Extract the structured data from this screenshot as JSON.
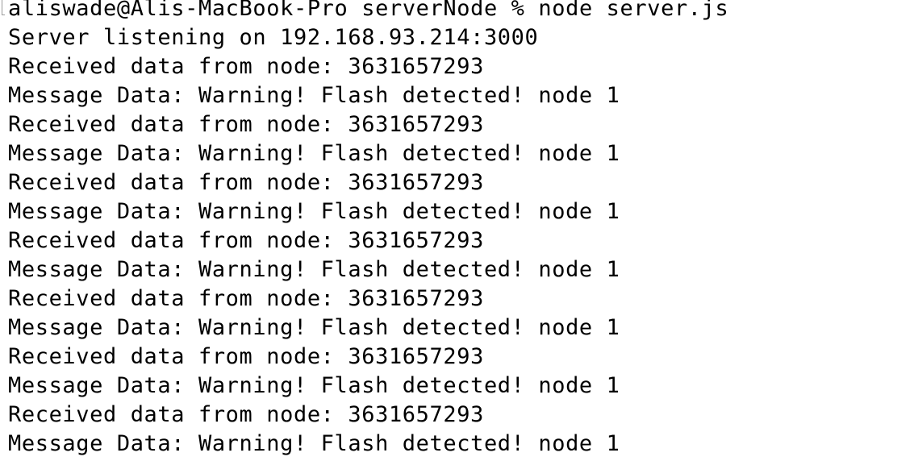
{
  "terminal": {
    "prompt": {
      "user_host": "aliswade@Alis-MacBook-Pro",
      "cwd": "serverNode",
      "symbol": "%",
      "command": "node server.js"
    },
    "lines": [
      "Server listening on 192.168.93.214:3000",
      "Received data from node: 3631657293",
      "Message Data: Warning! Flash detected! node 1",
      "Received data from node: 3631657293",
      "Message Data: Warning! Flash detected! node 1",
      "Received data from node: 3631657293",
      "Message Data: Warning! Flash detected! node 1",
      "Received data from node: 3631657293",
      "Message Data: Warning! Flash detected! node 1",
      "Received data from node: 3631657293",
      "Message Data: Warning! Flash detected! node 1",
      "Received data from node: 3631657293",
      "Message Data: Warning! Flash detected! node 1",
      "Received data from node: 3631657293",
      "Message Data: Warning! Flash detected! node 1"
    ]
  }
}
